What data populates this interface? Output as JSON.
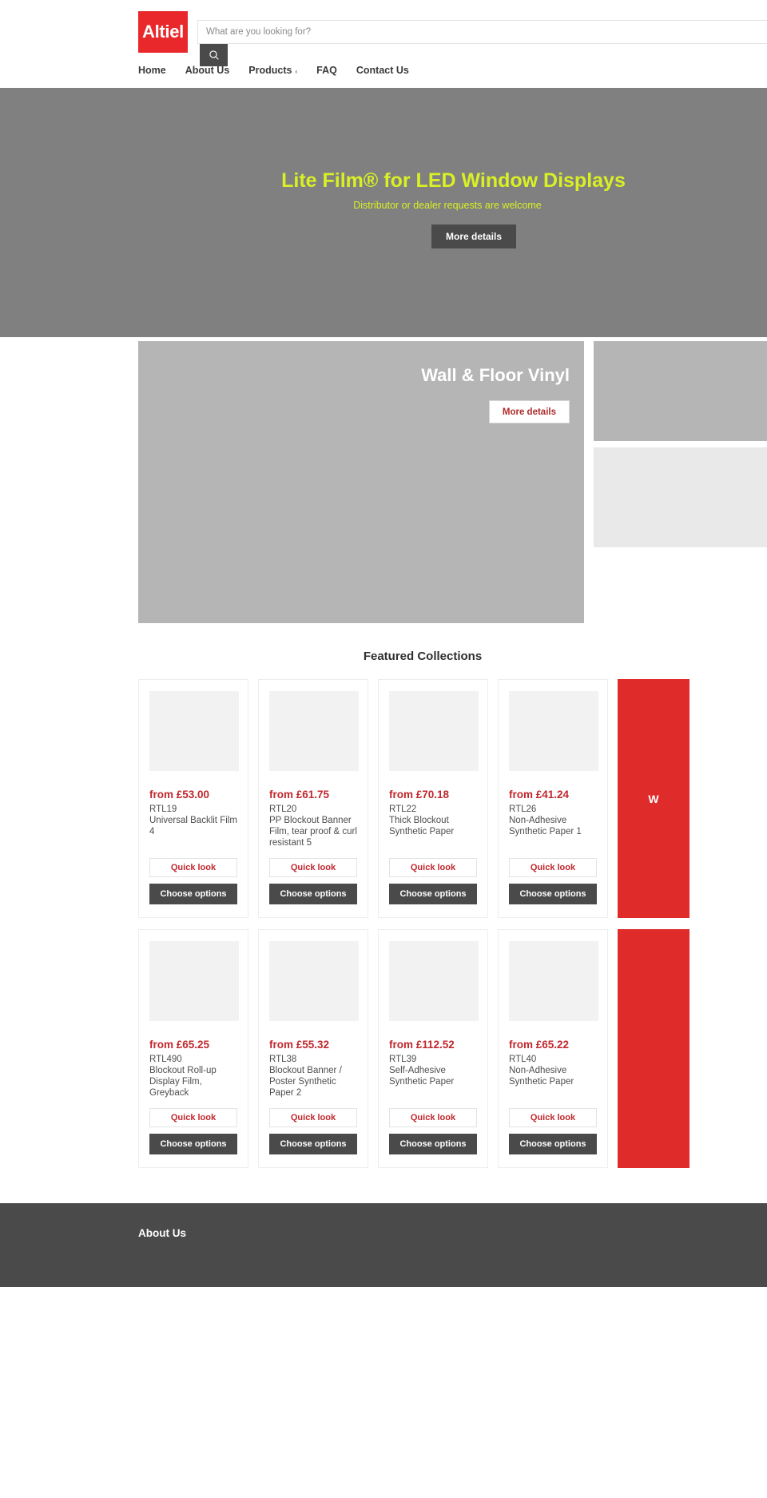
{
  "brand": {
    "logo_text": "Altiel",
    "logo_color": "#e8282b"
  },
  "search": {
    "placeholder": "What are you looking for?",
    "value": "",
    "button_icon": "search-icon"
  },
  "nav": {
    "items": [
      {
        "label": "Home"
      },
      {
        "label": "About Us"
      },
      {
        "label": "Products",
        "caret": "‹"
      },
      {
        "label": "FAQ"
      },
      {
        "label": "Contact Us"
      }
    ]
  },
  "hero": {
    "title": "Lite Film® for LED Window Displays",
    "subtitle": "Distributor or dealer requests are welcome",
    "button_label": "More details",
    "title_color": "#d9f024",
    "background_color": "#808080"
  },
  "collections": {
    "main": {
      "title": "Wall & Floor Vinyl",
      "button_label": "More details"
    },
    "side": [
      {
        "name": "collection-tile-top"
      },
      {
        "name": "collection-tile-bottom"
      }
    ]
  },
  "featured": {
    "heading": "Featured Collections",
    "quick_look_label": "Quick look",
    "choose_options_label": "Choose options",
    "promo_label": "W",
    "rows": [
      {
        "products": [
          {
            "price": "from £53.00",
            "sku": "RTL19",
            "name": "Universal Backlit Film 4"
          },
          {
            "price": "from £61.75",
            "sku": "RTL20",
            "name": "PP Blockout Banner Film, tear proof & curl resistant 5"
          },
          {
            "price": "from £70.18",
            "sku": "RTL22",
            "name": "Thick Blockout Synthetic Paper"
          },
          {
            "price": "from £41.24",
            "sku": "RTL26",
            "name": "Non-Adhesive Synthetic Paper 1"
          }
        ]
      },
      {
        "products": [
          {
            "price": "from £65.25",
            "sku": "RTL490",
            "name": "Blockout Roll-up Display Film, Greyback"
          },
          {
            "price": "from £55.32",
            "sku": "RTL38",
            "name": "Blockout Banner / Poster Synthetic Paper 2"
          },
          {
            "price": "from £112.52",
            "sku": "RTL39",
            "name": "Self-Adhesive Synthetic Paper"
          },
          {
            "price": "from £65.22",
            "sku": "RTL40",
            "name": "Non-Adhesive Synthetic Paper"
          }
        ]
      }
    ]
  },
  "footer": {
    "about_title": "About Us"
  }
}
